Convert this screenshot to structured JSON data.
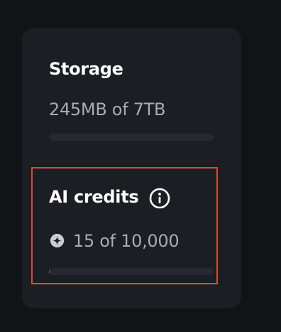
{
  "storage": {
    "title": "Storage",
    "usage": "245MB of 7TB",
    "fraction_used": 3e-05
  },
  "ai_credits": {
    "title": "AI credits",
    "usage": "15 of 10,000",
    "fraction_used": 0.0015,
    "info_icon": "info-icon",
    "credit_icon": "sparkle-icon"
  },
  "colors": {
    "highlight": "#e0492e",
    "card_background": "#1b1e22",
    "page_background": "#111417"
  }
}
